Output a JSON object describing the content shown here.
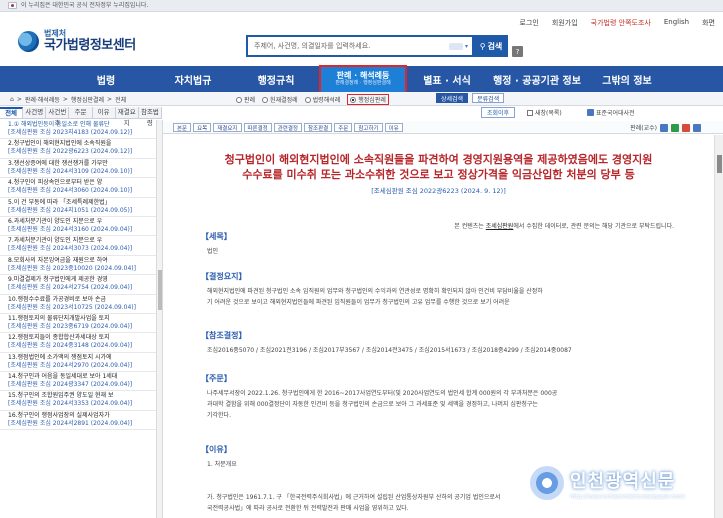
{
  "gov_bar": {
    "text": "이 누리집은 대한민국 공식 전자정부 누리집입니다."
  },
  "util_links": [
    "로그인",
    "회원가입",
    "국가법령 안쪽도조사",
    "English",
    "화면"
  ],
  "logo": {
    "small": "법제처",
    "big": "국가법령정보센터"
  },
  "search": {
    "placeholder": "주제어, 사건명, 의결일자를 입력하세요.",
    "button": "검색",
    "help": "?"
  },
  "main_nav": [
    {
      "label": "법령"
    },
    {
      "label": "자치법규"
    },
    {
      "label": "행정규칙"
    },
    {
      "label": "판례 · 해석례등",
      "sub": "판례결정례 · 행정심판결례"
    },
    {
      "label": "별표 · 서식"
    },
    {
      "label": "행정 · 공공기관 정보"
    },
    {
      "label": "그밖의 정보"
    }
  ],
  "breadcrumb": [
    "판례·해석례등",
    "행정심판결례",
    "전체"
  ],
  "radio_options": [
    {
      "label": "판례",
      "selected": false
    },
    {
      "label": "헌재결정례",
      "selected": false
    },
    {
      "label": "법령해석례",
      "selected": false
    },
    {
      "label": "행정심판례",
      "selected": true
    }
  ],
  "sub_buttons": [
    "상세검색",
    "분류검색"
  ],
  "left_tabs": [
    "전체",
    "사건명",
    "사건번호",
    "주문",
    "이유",
    "재결요지",
    "참조법령"
  ],
  "left_list": [
    {
      "title": "1.① 해외법인등이 동일소로 인해 물류단",
      "meta": "[조세심판원 조심 2023지4183 (2024.09.12)]"
    },
    {
      "title": "2.청구법인이 해외현지법인에 소속직원을",
      "meta": "[조세심판원 조심 2022광6223 (2024.09.12)]"
    },
    {
      "title": "3.쟁선상증여에 대한 쟁선쟁거를 가부만",
      "meta": "[조세심판원 조심 2024서3109 (2024.09.10)]"
    },
    {
      "title": "4.청구인이 피상속인으로부터 받은 양",
      "meta": "[조세심판원 조심 2024서3060 (2024.09.10)]"
    },
    {
      "title": "5.이 건 부동에 따라 「조세특례제한법」",
      "meta": "[조세심판원 조심 2024지1051 (2024.09.05)]"
    },
    {
      "title": "6.과세처분기관이 양도인 지분으로 우",
      "meta": "[조세심판원 조심 2024서3160 (2024.09.04)]"
    },
    {
      "title": "7.과세처분기관이 양도인 지분으로 우",
      "meta": "[조세심판원 조심 2024서3073 (2024.09.04)]"
    },
    {
      "title": "8.모회사의 자본잉여금을 재원으로 하여",
      "meta": "[조세심판원 조심 2023중10020 (2024.09.04)]"
    },
    {
      "title": "9.미결결제가 청구법인에게 제공한 경영",
      "meta": "[조세심판원 조심 2024서2754 (2024.09.04)]"
    },
    {
      "title": "10.쟁점수수료를 가공경비로 보아 손금",
      "meta": "[조세심판원 조심 2023서10725 (2024.09.04)]"
    },
    {
      "title": "11.쟁점토지의 물류단지개발사업을 토지",
      "meta": "[조세심판원 조심 2023중6719 (2024.09.04)]"
    },
    {
      "title": "12.쟁점토지들이 종합합산과세대상 토지",
      "meta": "[조세심판원 조심 2024중3148 (2024.09.04)]"
    },
    {
      "title": "13.쟁점법인에 소가액의 쟁점토지 시가에",
      "meta": "[조세심판원 조심 2024서2970 (2024.09.04)]"
    },
    {
      "title": "14.청구인과 어음을 동일세대로 보아 1세대",
      "meta": "[조세심판원 조심 2024광3347 (2024.09.04)]"
    },
    {
      "title": "15.청구인의 조합원입주권 양도일 현재 보",
      "meta": "[조세심판원 조심 2024서3353 (2024.09.04)]"
    },
    {
      "title": "16.청구인이 쟁점사업장의 실제사업자가",
      "meta": "[조세심판원 조심 2024서2891 (2024.09.04)]"
    }
  ],
  "right_bar": {
    "zoom": "조회이후",
    "new_window": "새창(목록)",
    "print_link": "표준국어대사전"
  },
  "doc_toolbar": {
    "buttons": [
      "본문",
      "요목",
      "재결요지",
      "따른결정",
      "관련결정",
      "참조판결",
      "주문",
      "참고하기",
      "이유"
    ],
    "right_label": "판례(교수)"
  },
  "doc": {
    "title_line1": "청구법인이 해외현지법인에 소속직원들을 파견하여 경영지원용역을 제공하였음에도 경영지원",
    "title_line2": "수수료를 미수취 또는 과소수취한 것으로 보고 정상가격을 익금산입한 처분의 당부 등",
    "ref": "[조세심판원 조심 2022광6223 (2024. 9. 12)]",
    "note_prefix": "본 컨텐츠는 ",
    "note_org": "조세심판원",
    "note_suffix": "에서 수집한 데이터로, 관련 문의는 해당 기관으로 부탁드립니다.",
    "sections": [
      {
        "head": "【세목】",
        "body": [
          "법인"
        ]
      },
      {
        "head": "【결정요지】",
        "body": [
          "해외현지법인에 파견된 청구법인 소속 임직원의 업무와 청구법인의 수익과의 연관성로 명확히 확인되지 않아 인건비 부담비율을 산정하",
          "기 어려운 것으로 보이고 해외현지법인들에 파견된 임직원들이 업무가 청구법인의 고유 업무를 수행한 것으로 보기 어려운"
        ]
      },
      {
        "head": "【참조결정】",
        "body": [
          "조심2016중5070 / 조심2021전3196 / 조심2017부3567 / 조심2014전3475 / 조심2015서1673 / 조심2018중4299 / 조심2014중0087"
        ]
      },
      {
        "head": "【주문】",
        "body": [
          "나주세무서장이 2022.1.26. 청구법인에게 한 2016~2017사업연도부터(및 2020사업연도의 법인세 합계 000원의 각 부과처분은 000공",
          "과대학 결함을 위해 000결정단이 자동한 인건비 등을 청구법인의 손금으로 보아 그 과세표준 및 세액을 경정하고, 나머지 심판청구는",
          "기각한다."
        ]
      },
      {
        "head": "【이유】",
        "body": [
          "1. 처분개요",
          "",
          "",
          "가. 청구법인은 1961.7.1. 구 「한국전력주식회사법」에 근거하여 설립된 산업통상자원부 산하의 공기업 법인으로서",
          "국전력공사법」에 따라 공사로 전환한 뒤 전력발전과 판매 사업을 영위하고 있다."
        ]
      }
    ]
  },
  "watermark": {
    "name": "인천광역신문",
    "url": "http://www.incheonmetronewspaper.com/"
  },
  "colors": {
    "nav_bg": "#2757a4",
    "nav_active": "#1d7fd6",
    "title_red": "#b6262a",
    "section_blue": "#2a5db0",
    "highlight_border": "#e0262b"
  }
}
